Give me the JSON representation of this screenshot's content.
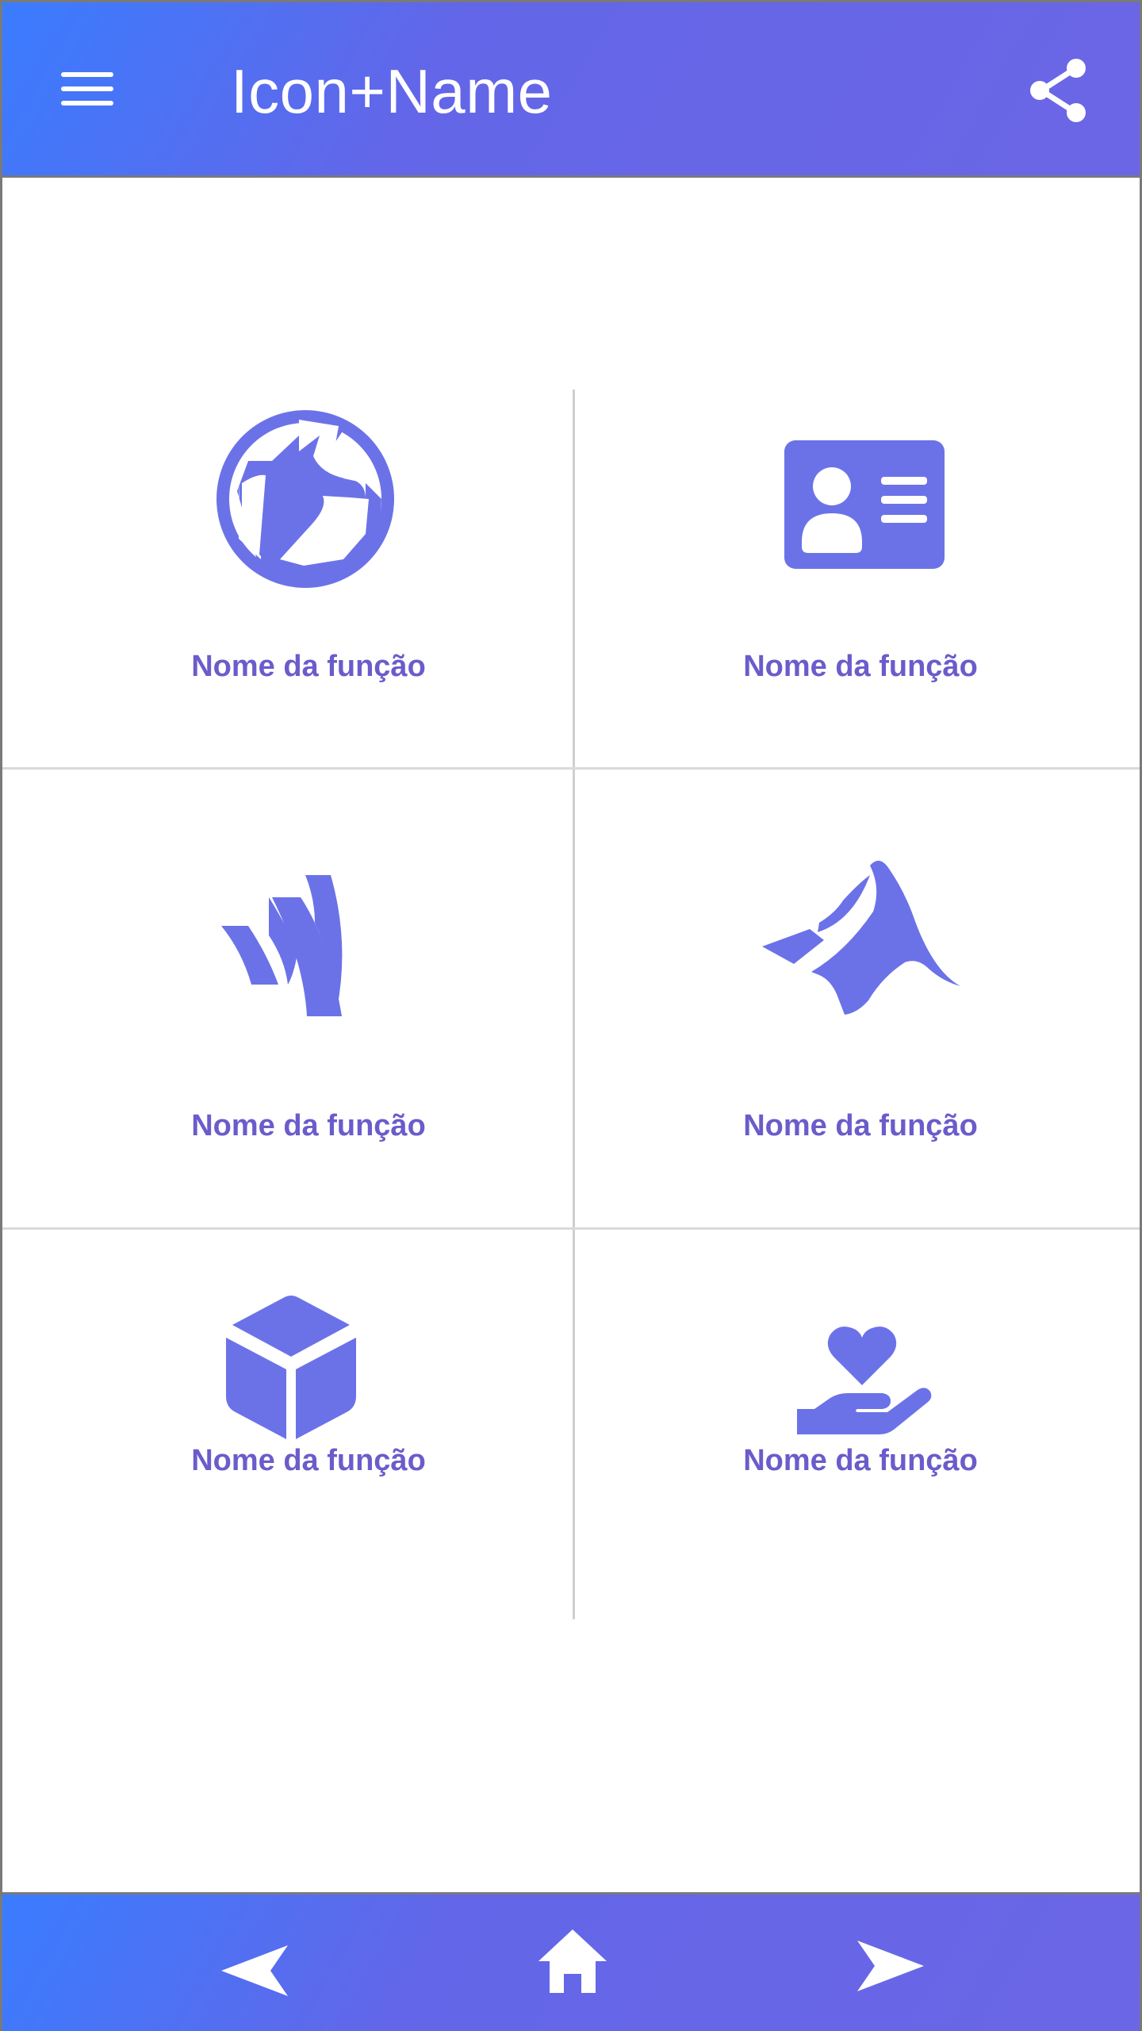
{
  "header": {
    "title": "Icon+Name",
    "menu_icon": "hamburger-menu-icon",
    "share_icon": "share-icon"
  },
  "colors": {
    "bar_gradient_start": "#3a7cff",
    "bar_gradient_end": "#6b66e6",
    "icon_color": "#6b72e8",
    "label_color": "#6a5ccb",
    "divider_color": "#d0d0d0"
  },
  "tiles": [
    {
      "label": "Nome da função",
      "icon": "globe-icon"
    },
    {
      "label": "Nome da função",
      "icon": "id-card-icon"
    },
    {
      "label": "Nome da função",
      "icon": "wikifolio-stripes-icon"
    },
    {
      "label": "Nome da função",
      "icon": "matlab-icon"
    },
    {
      "label": "Nome da função",
      "icon": "cube-icon"
    },
    {
      "label": "Nome da função",
      "icon": "hand-holding-heart-icon"
    }
  ],
  "bottom_nav": {
    "back_icon": "chevron-left-icon",
    "home_icon": "home-icon",
    "forward_icon": "chevron-right-icon"
  }
}
